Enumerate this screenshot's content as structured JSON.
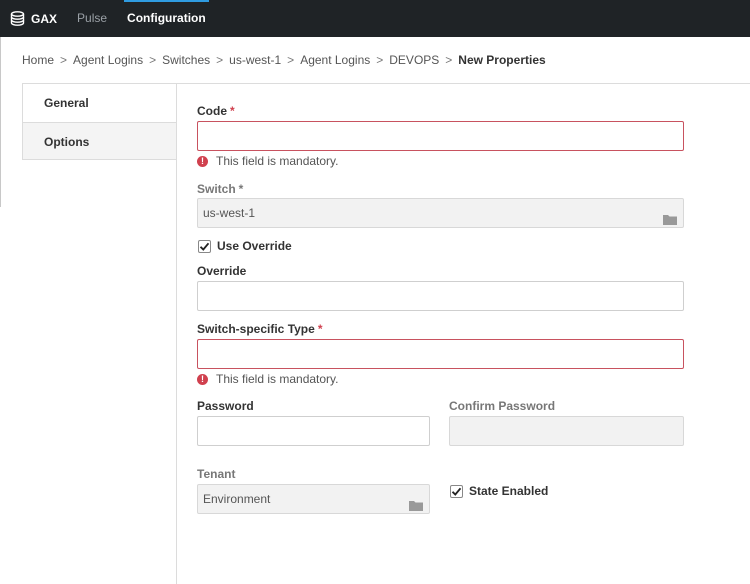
{
  "topbar": {
    "app_name": "GAX",
    "nav": [
      {
        "label": "Pulse",
        "active": false
      },
      {
        "label": "Configuration",
        "active": true
      }
    ],
    "accent_color": "#2f9be0",
    "logo_icon": "database-icon"
  },
  "breadcrumb": [
    "Home",
    "Agent Logins",
    "Switches",
    "us-west-1",
    "Agent Logins",
    "DEVOPS",
    "New Properties"
  ],
  "breadcrumb_separator": ">",
  "tabs": [
    {
      "label": "General",
      "selected": true
    },
    {
      "label": "Options",
      "selected": false
    }
  ],
  "form": {
    "required_mark": "*",
    "code": {
      "label": "Code",
      "value": "",
      "error": "This field is mandatory."
    },
    "switch": {
      "label": "Switch",
      "value": "us-west-1"
    },
    "use_override": {
      "label": "Use Override",
      "checked": true
    },
    "override": {
      "label": "Override",
      "value": ""
    },
    "switch_type": {
      "label": "Switch-specific Type",
      "value": "",
      "error": "This field is mandatory."
    },
    "password": {
      "label": "Password",
      "value": ""
    },
    "confirm_password": {
      "label": "Confirm Password",
      "value": ""
    },
    "tenant": {
      "label": "Tenant",
      "value": "Environment"
    },
    "state_enabled": {
      "label": "State Enabled",
      "checked": true
    },
    "error_icon_glyph": "!",
    "error_color": "#d0404e"
  }
}
